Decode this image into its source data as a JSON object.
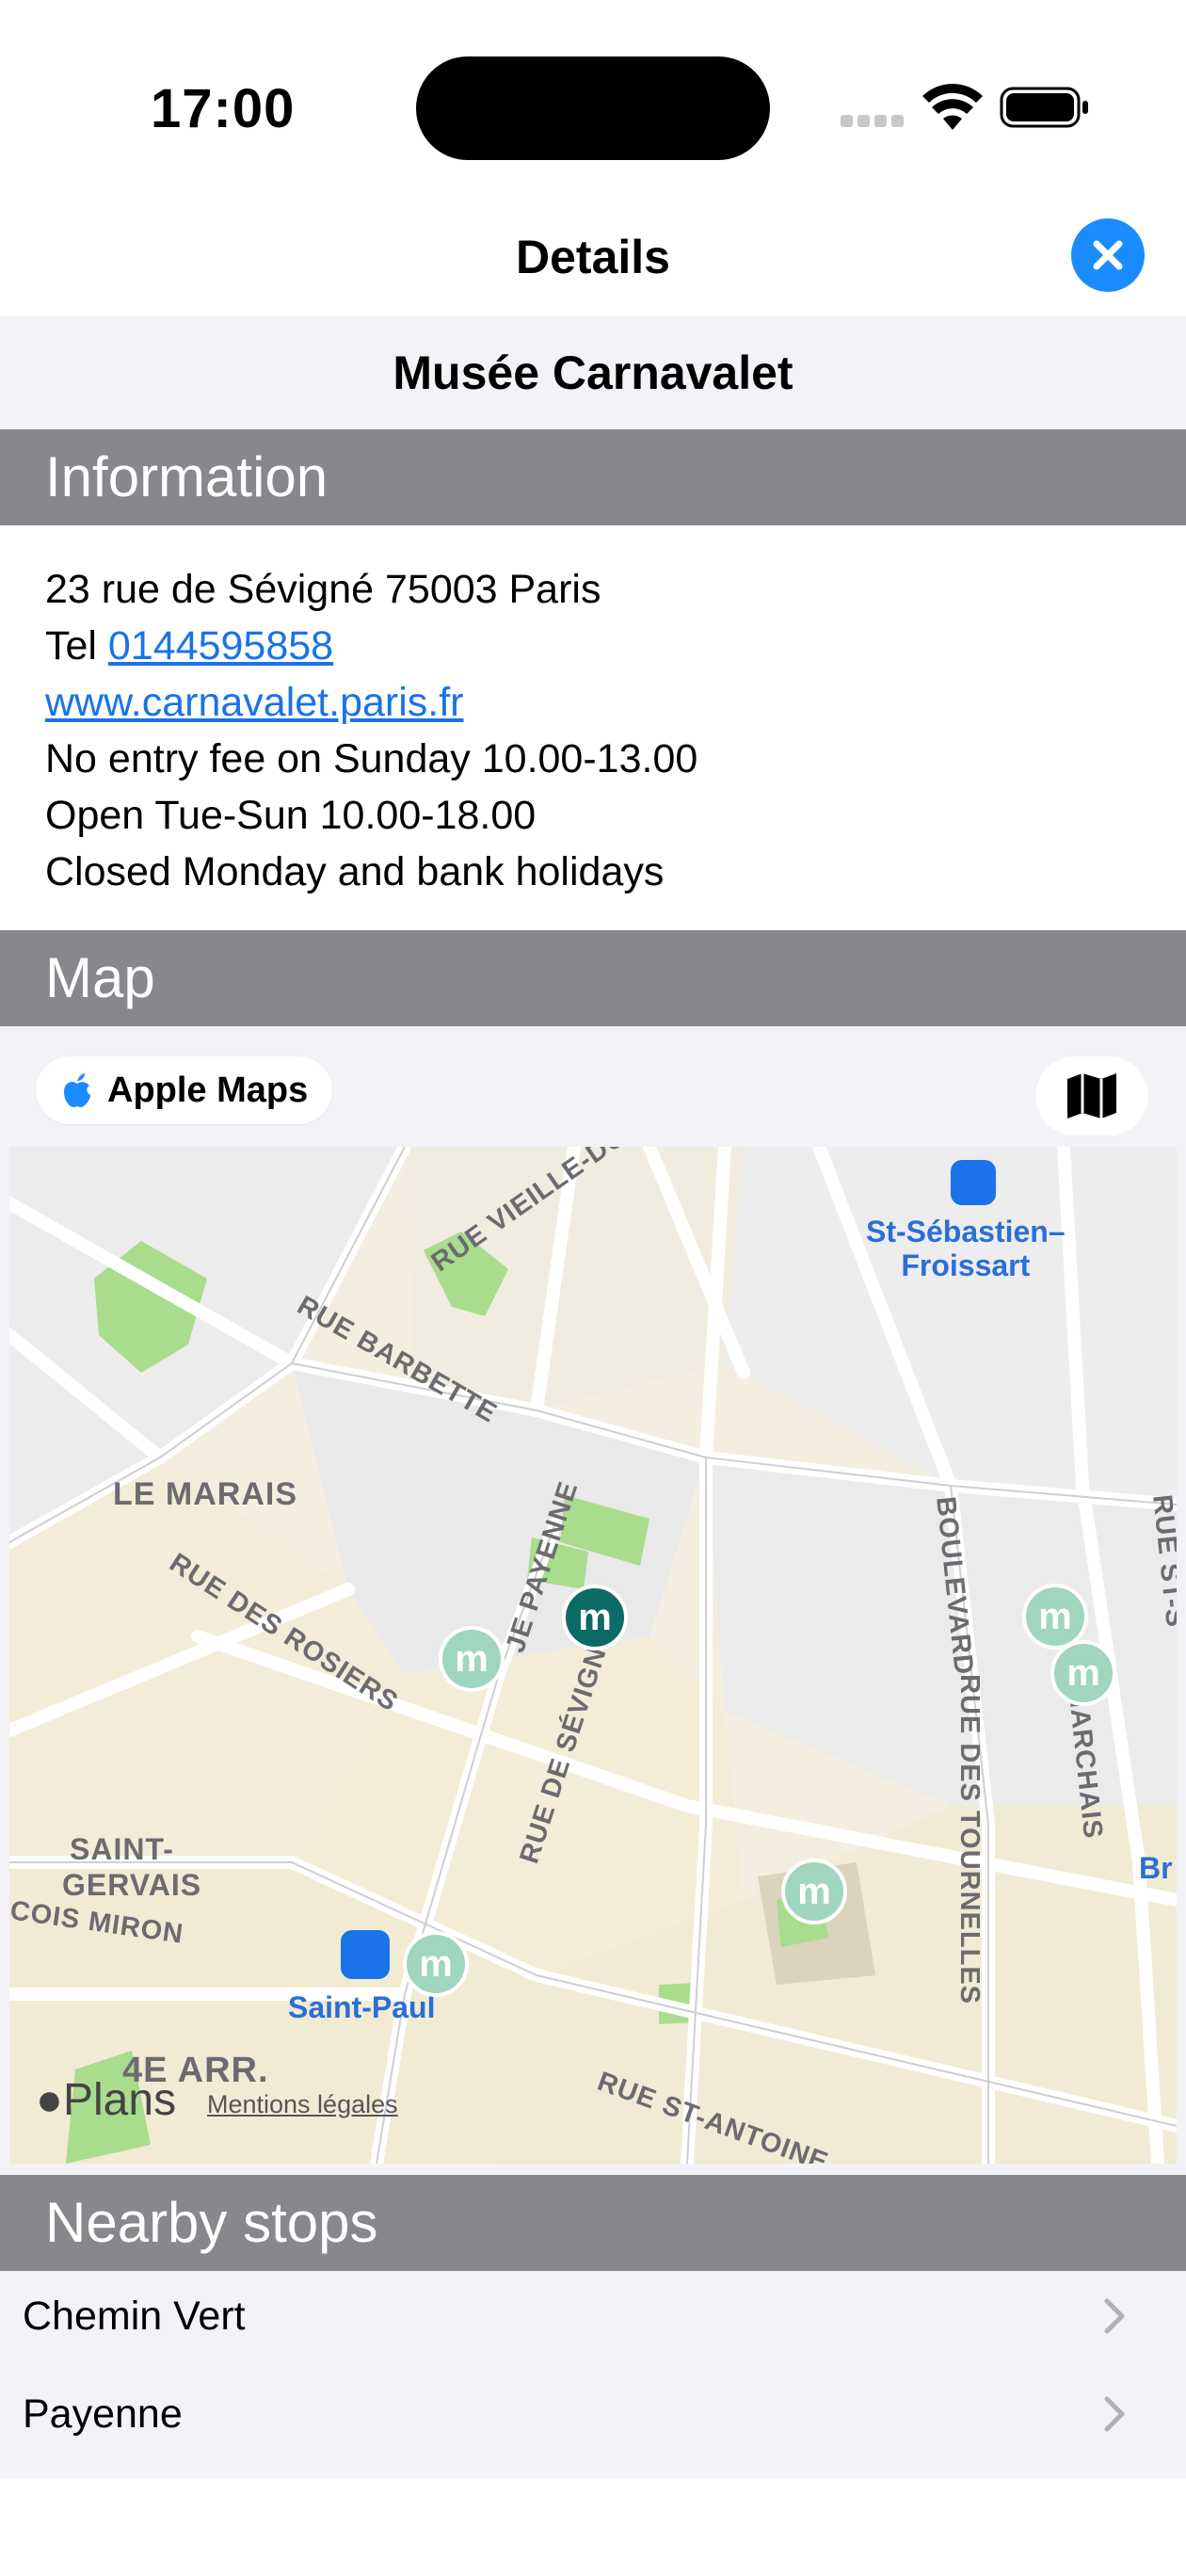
{
  "status_bar": {
    "time": "17:00"
  },
  "nav": {
    "title": "Details",
    "close_icon": "xmark-circle-icon"
  },
  "place": {
    "name": "Musée Carnavalet"
  },
  "information": {
    "header": "Information",
    "address": "23 rue de Sévigné 75003 Paris",
    "tel_label": "Tel",
    "tel": "0144595858",
    "website": "www.carnavalet.paris.fr",
    "fee_note": "No entry fee on Sunday 10.00-13.00",
    "hours": "Open Tue-Sun 10.00-18.00",
    "closed": "Closed Monday and bank holidays"
  },
  "map": {
    "header": "Map",
    "apple_maps_label": "Apple Maps",
    "map_mode_icon": "map-icon",
    "plans_label": "Plans",
    "legal_label": "Mentions légales",
    "labels": {
      "rue_vieille_du": "RUE VIEILLE-DU",
      "st_sebastien_1": "St-Sébastien–",
      "st_sebastien_2": "Froissart",
      "rue_barbette": "RUE BARBETTE",
      "le_marais": "LE MARAIS",
      "payenne": "JE PAYENNE",
      "rue_des_rosiers": "RUE DES ROSIERS",
      "rue_de_sevigne": "RUE DE SÉVIGNÉ",
      "boulevard": "BOULEVARD",
      "marchais": "MARCHAIS",
      "rue_des_tournelles": "RUE DES TOURNELLES",
      "rue_st": "RUE ST-S",
      "saint_gervais_1": "SAINT-",
      "saint_gervais_2": "GERVAIS",
      "cois_miron": "COIS MIRON",
      "saint_paul": "Saint-Paul",
      "arr": "4E ARR.",
      "rue_st_antoine": "RUE ST-ANTOINE",
      "br": "Br",
      "metro_glyph": "m"
    }
  },
  "nearby": {
    "header": "Nearby stops",
    "stops": [
      {
        "label": "Chemin Vert"
      },
      {
        "label": "Payenne"
      }
    ]
  }
}
